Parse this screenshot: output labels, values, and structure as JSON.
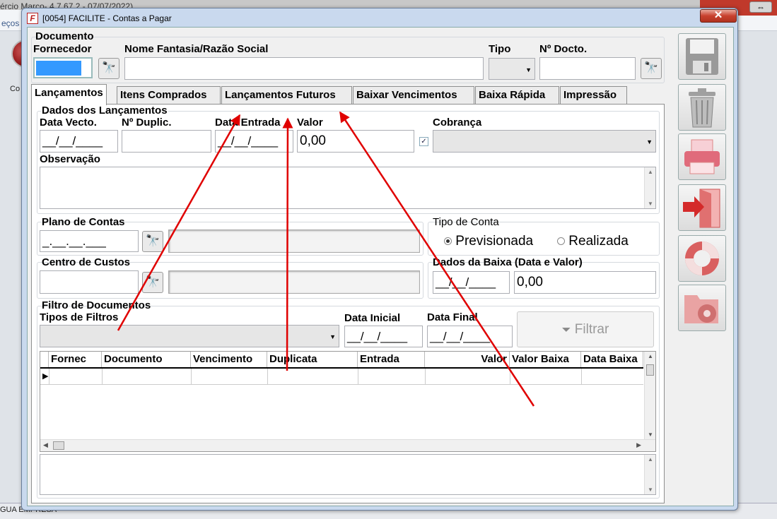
{
  "background": {
    "title_fragment": "ércio Março- 4.7.67.2 - 07/07/2022)",
    "menu_fragment": "eços",
    "side_text": "Co",
    "status_left": "GUA EMPRESA"
  },
  "window": {
    "icon": "F",
    "title": "[0054] FACILITE - Contas a Pagar",
    "close_symbol": "✕"
  },
  "header": {
    "documento": "Documento",
    "fornecedor": "Fornecedor",
    "nome_fantasia": "Nome Fantasia/Razão Social",
    "tipo": "Tipo",
    "no_docto": "Nº Docto."
  },
  "tabs": [
    "Lançamentos",
    "Itens Comprados",
    "Lançamentos Futuros",
    "Baixar Vencimentos",
    "Baixa Rápida",
    "Impressão"
  ],
  "lancamentos": {
    "group_title": "Dados dos Lançamentos",
    "data_vecto": "Data Vecto.",
    "no_duplic": "Nº Duplic.",
    "data_entrada": "Data Entrada",
    "valor": "Valor",
    "cobranca": "Cobrança",
    "date_mask": "__/__/____",
    "valor_value": "0,00",
    "observacao": "Observação"
  },
  "plano": {
    "label": "Plano de Contas",
    "mask": "_.__.__.___"
  },
  "tipo_conta": {
    "label": "Tipo de Conta",
    "opt1": "Previsionada",
    "opt2": "Realizada"
  },
  "centro": {
    "label": "Centro de Custos"
  },
  "baixa": {
    "label": "Dados da Baixa (Data e Valor)",
    "date_mask": "__/__/____",
    "value": "0,00"
  },
  "filtro": {
    "group_title": "Filtro de Documentos",
    "tipos": "Tipos de Filtros",
    "data_inicial": "Data Inicial",
    "data_final": "Data Final",
    "date_mask": "__/__/____",
    "button": "Filtrar"
  },
  "grid": {
    "columns": [
      "Fornec",
      "Documento",
      "Vencimento",
      "Duplicata",
      "Entrada",
      "Valor",
      "Valor Baixa",
      "Data Baixa"
    ]
  },
  "colors": {
    "annotation_arrow": "#e00000",
    "dialog_frame": "#c9d9ee"
  }
}
